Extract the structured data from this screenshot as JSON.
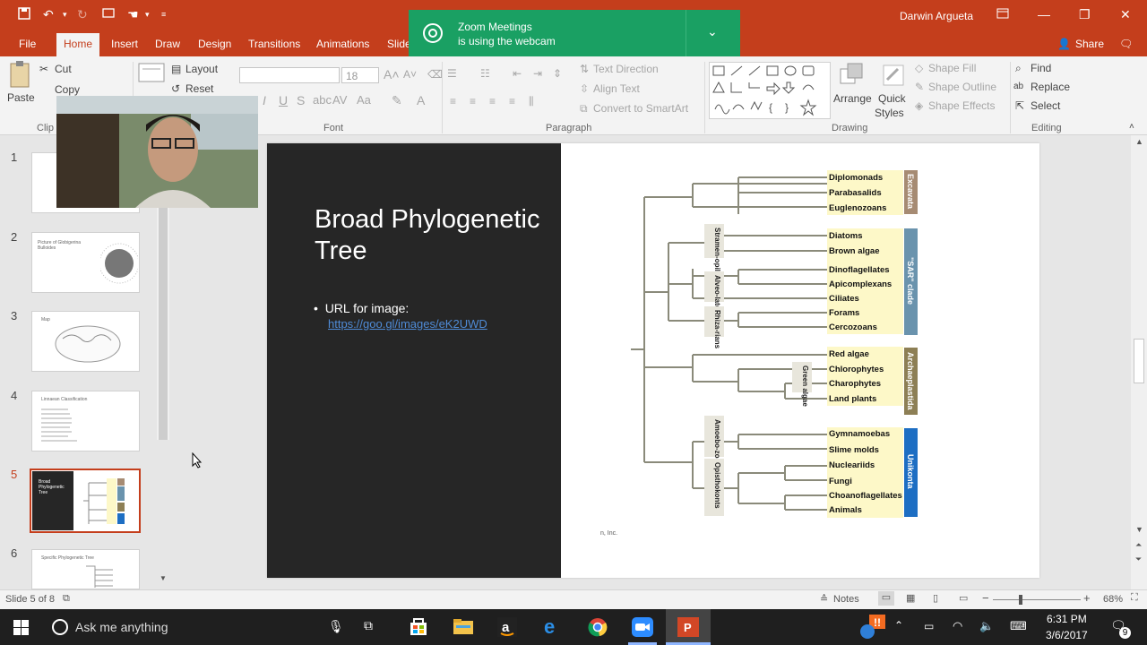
{
  "titlebar": {
    "user": "Darwin Argueta",
    "quick_access": [
      "save",
      "undo",
      "redo",
      "start-from-beginning",
      "touch-mode",
      "customize"
    ]
  },
  "tabs": [
    "File",
    "Home",
    "Insert",
    "Draw",
    "Design",
    "Transitions",
    "Animations",
    "Slide"
  ],
  "active_tab": "Home",
  "share_label": "Share",
  "toast": {
    "line1": "Zoom Meetings",
    "line2": "is using the webcam"
  },
  "ribbon": {
    "clipboard": {
      "paste": "Paste",
      "cut": "Cut",
      "copy": "Copy",
      "group": "Clip"
    },
    "slides": {
      "layout": "Layout",
      "reset": "Reset"
    },
    "font": {
      "size": "18",
      "group": "Font"
    },
    "paragraph": {
      "text_direction": "Text Direction",
      "align_text": "Align Text",
      "convert": "Convert to SmartArt",
      "group": "Paragraph"
    },
    "drawing": {
      "arrange": "Arrange",
      "quick_styles_1": "Quick",
      "quick_styles_2": "Styles",
      "shape_fill": "Shape Fill",
      "shape_outline": "Shape Outline",
      "shape_effects": "Shape Effects",
      "group": "Drawing"
    },
    "editing": {
      "find": "Find",
      "replace": "Replace",
      "select": "Select",
      "group": "Editing"
    }
  },
  "slides_panel": [
    {
      "num": "1"
    },
    {
      "num": "2",
      "title": "Picture of Globigerina Bulloides"
    },
    {
      "num": "3",
      "title": "Map"
    },
    {
      "num": "4",
      "title": "Linnaean Classification"
    },
    {
      "num": "5",
      "title": "Broad Phylogenetic Tree",
      "selected": true
    },
    {
      "num": "6",
      "title": "Specific Phylogenetic Tree"
    }
  ],
  "slide": {
    "title": "Broad Phylogenetic Tree",
    "bullet": "URL for image:",
    "url": "https://goo.gl/images/eK2UWD",
    "credit": "n, Inc."
  },
  "tree": {
    "supergroups": [
      {
        "name": "Excavata",
        "color": "#a68b73",
        "taxa": [
          "Diplomonads",
          "Parabasalids",
          "Euglenozoans"
        ]
      },
      {
        "name": "\"SAR\" clade",
        "color": "#6a93ad",
        "taxa": [
          "Diatoms",
          "Brown algae",
          "Dinoflagellates",
          "Apicomplexans",
          "Ciliates",
          "Forams",
          "Cercozoans"
        ]
      },
      {
        "name": "Archaeplastida",
        "color": "#8d7f55",
        "taxa": [
          "Red algae",
          "Chlorophytes",
          "Charophytes",
          "Land plants"
        ]
      },
      {
        "name": "Unikonta",
        "color": "#1d6ec3",
        "taxa": [
          "Gymnamoebas",
          "Slime molds",
          "Nucleariids",
          "Fungi",
          "Choanoflagellates",
          "Animals"
        ]
      }
    ],
    "subgroups": [
      "Stramen-opiles",
      "Alveo-lates",
      "Rhiza-rians",
      "Green algae",
      "Amoebo-zoans",
      "Opisthokonts"
    ]
  },
  "status": {
    "slide_info": "Slide 5 of 8",
    "notes": "Notes",
    "zoom": "68%"
  },
  "taskbar": {
    "search": "Ask me anything",
    "time": "6:31 PM",
    "date": "3/6/2017",
    "notifications": "9"
  },
  "colors": {
    "accent": "#c43e1c",
    "toast": "#1aa063",
    "taxa_bg": "#fdf8c8"
  }
}
